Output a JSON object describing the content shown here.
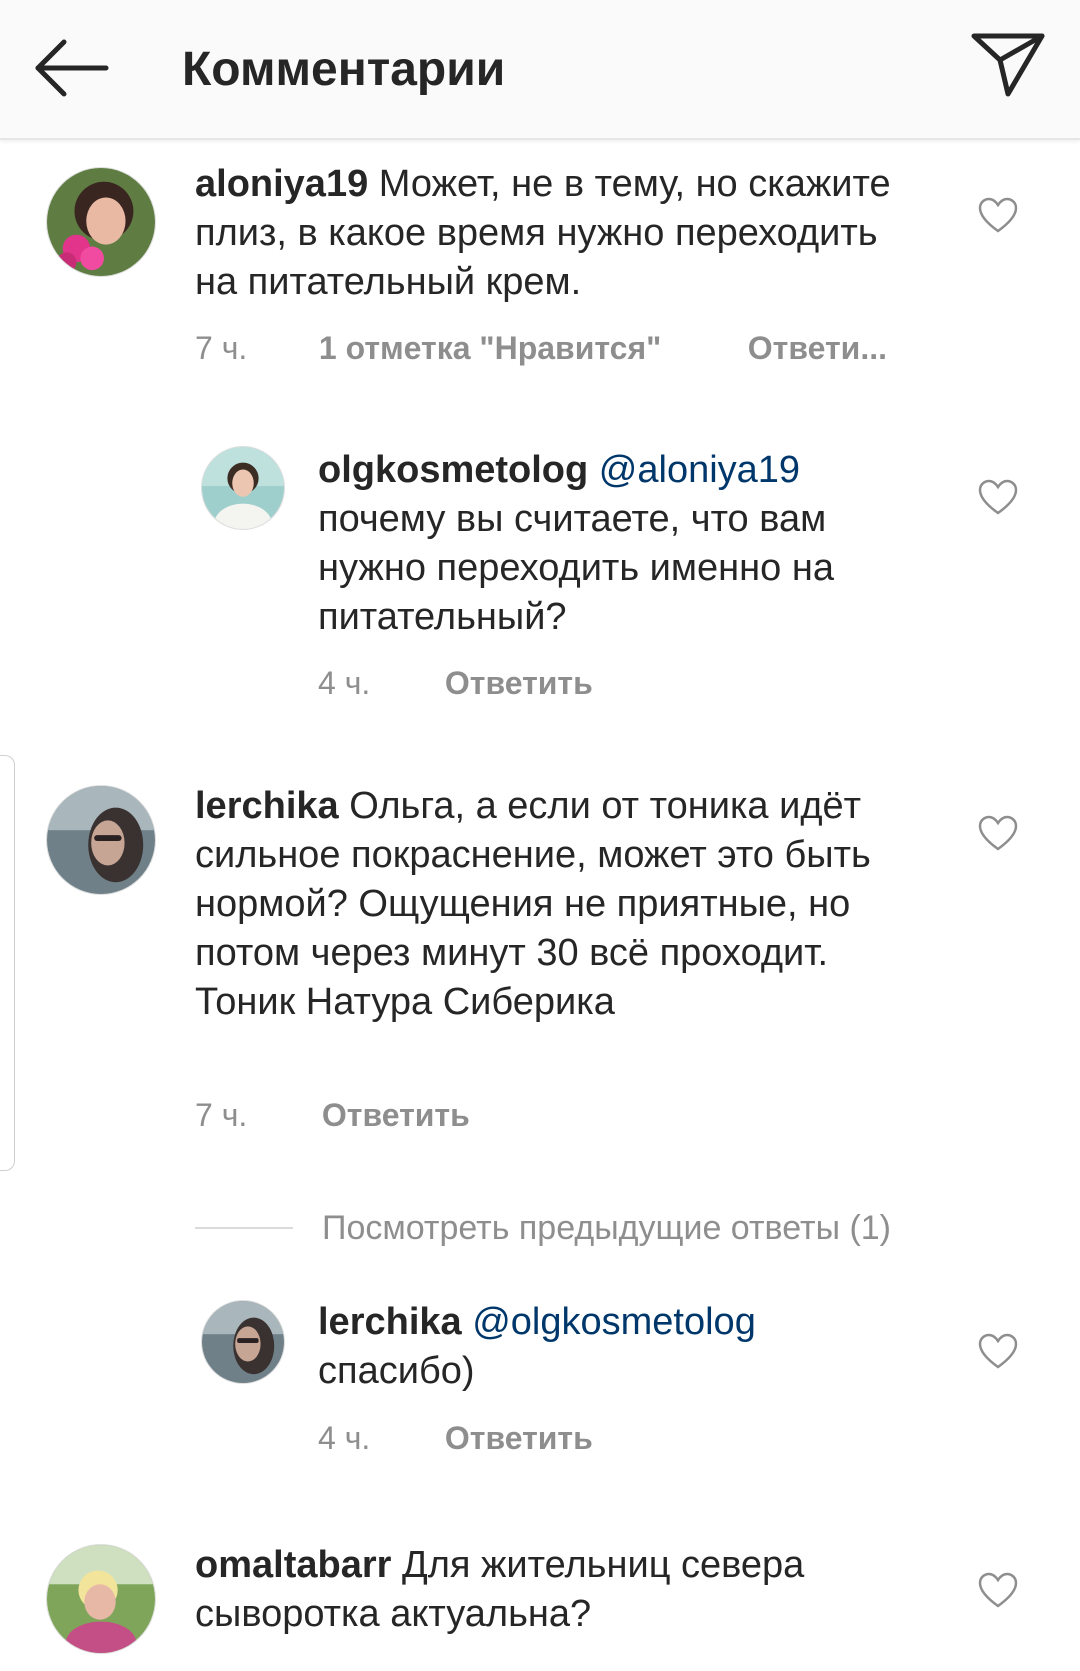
{
  "header": {
    "title": "Комментарии",
    "back_icon": "arrow-left-icon",
    "send_icon": "paper-plane-icon"
  },
  "comments": [
    {
      "username": "aloniya19",
      "mention": "",
      "text": "Может, не в тему, но скажите  плиз, в какое время нужно переходить на питательный крем.",
      "time": "7 ч.",
      "likes": "1 отметка \"Нравится\"",
      "reply": "Ответи..."
    },
    {
      "username": "olgkosmetolog",
      "mention": "@aloniya19",
      "text": "почему вы считаете, что вам нужно переходить именно на питательный?",
      "time": "4 ч.",
      "reply": "Ответить"
    },
    {
      "username": "lerchika",
      "mention": "",
      "text": "Ольга, а если от тоника идёт сильное покраснение, может это быть нормой? Ощущения не приятные, но потом через минут 30 всё проходит. Тоник Натура Сиберика",
      "time": "7 ч.",
      "reply": "Ответить"
    },
    {
      "username": "lerchika",
      "mention": "@olgkosmetolog",
      "text": "спасибо)",
      "time": "4 ч.",
      "reply": "Ответить"
    },
    {
      "username": "omaltabarr",
      "mention": "",
      "text": "Для жительниц севера сыворотка актуальна?"
    }
  ],
  "view_previous_replies": "Посмотреть предыдущие ответы (1)",
  "colors": {
    "text": "#262626",
    "secondary": "#8e8e8e",
    "mention": "#00376b",
    "header_bg": "#fafafa"
  }
}
